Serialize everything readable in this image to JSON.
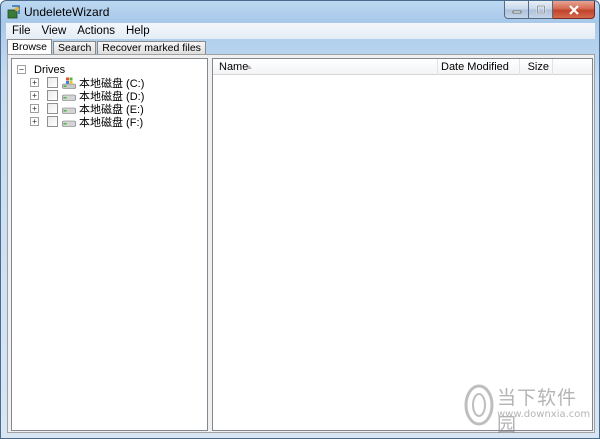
{
  "window": {
    "title": "UndeleteWizard",
    "buttons": {
      "minimize_icon": "minimize-icon",
      "maximize_icon": "maximize-icon",
      "close_icon": "close-icon"
    }
  },
  "menu": [
    "File",
    "View",
    "Actions",
    "Help"
  ],
  "tabs": [
    {
      "label": "Browse",
      "active": true
    },
    {
      "label": "Search",
      "active": false
    },
    {
      "label": "Recover marked files",
      "active": false
    }
  ],
  "tree": {
    "root": {
      "label": "Drives",
      "expander": "⊟"
    },
    "items": [
      {
        "label": "本地磁盘 (C:)",
        "expander": "+",
        "icon": "windows-drive-icon"
      },
      {
        "label": "本地磁盘 (D:)",
        "expander": "+",
        "icon": "hard-drive-icon"
      },
      {
        "label": "本地磁盘 (E:)",
        "expander": "+",
        "icon": "hard-drive-icon"
      },
      {
        "label": "本地磁盘 (F:)",
        "expander": "+",
        "icon": "hard-drive-icon"
      }
    ]
  },
  "list": {
    "columns": {
      "name": "Name",
      "date_modified": "Date Modified",
      "size": "Size"
    },
    "sort_icon": "sort-ascending-icon"
  },
  "watermark": {
    "title": "当下软件园",
    "url": "www.downxia.com"
  },
  "colors": {
    "title_bar": "#a9c9ea",
    "close_button": "#c2432b",
    "pane_border": "#828790"
  }
}
